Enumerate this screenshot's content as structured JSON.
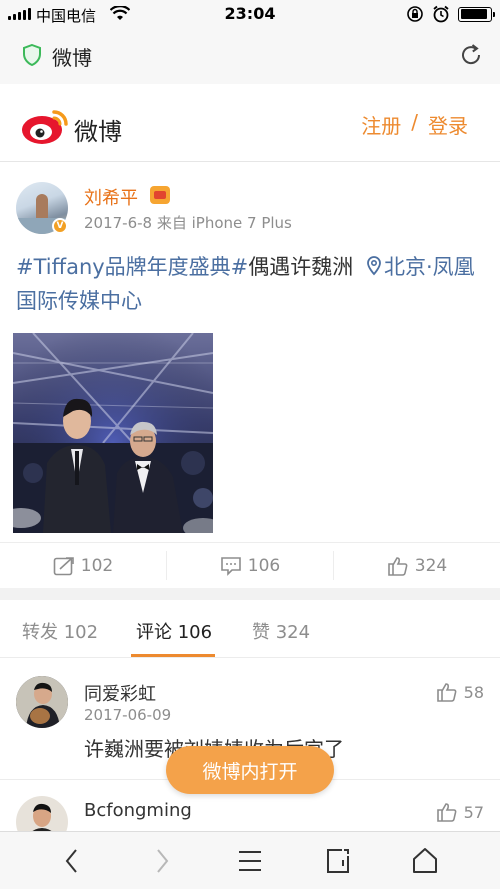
{
  "status_bar": {
    "carrier": "中国电信",
    "time": "23:04",
    "battery_level": 0.9
  },
  "browser": {
    "title": "微博"
  },
  "header": {
    "logo_text": "微博",
    "register_label": "注册",
    "separator": "/",
    "login_label": "登录"
  },
  "post": {
    "author": "刘希平",
    "meta": "2017-6-8 来自 iPhone 7 Plus",
    "tag": "#Tiffany品牌年度盛典#",
    "text": "偶遇许魏洲",
    "location": "北京·凤凰国际传媒中心",
    "actions": {
      "repost": "102",
      "comment": "106",
      "like": "324"
    }
  },
  "tabs": [
    {
      "label": "转发 102"
    },
    {
      "label": "评论 106"
    },
    {
      "label": "赞 324"
    }
  ],
  "comments": [
    {
      "name": "同爱彩虹",
      "time": "2017-06-09",
      "text": "许巍洲要被刘婊婊收为后宫了",
      "likes": "58"
    },
    {
      "name": "Bcfongming",
      "likes": "57"
    }
  ],
  "open_app_label": "微博内打开",
  "colors": {
    "accent": "#ed8a2f",
    "link": "#4b6fa1",
    "open_button": "#f4a24a"
  }
}
